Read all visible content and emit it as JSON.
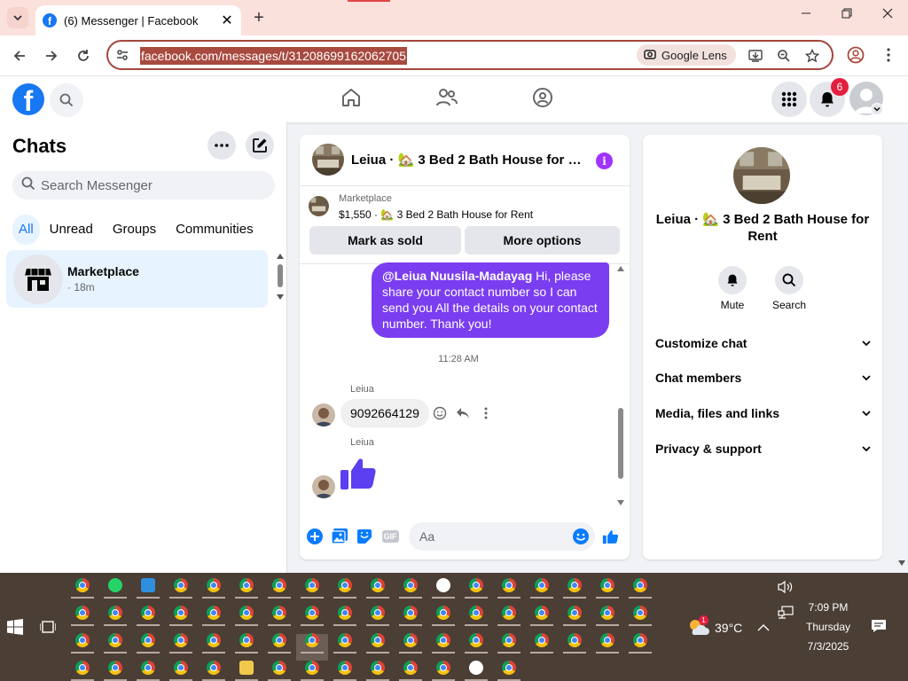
{
  "browser": {
    "tab_title": "(6) Messenger | Facebook",
    "tab_close": "✕",
    "new_tab": "+",
    "url": "facebook.com/messages/t/31208699162062705",
    "lens_label": "Google Lens",
    "accent_color": "#a84a3f"
  },
  "facebook": {
    "logo_letter": "f",
    "notification_count": "6",
    "brand_color": "#1877f2"
  },
  "chats": {
    "title": "Chats",
    "search_placeholder": "Search Messenger",
    "filters": [
      "All",
      "Unread",
      "Groups",
      "Communities"
    ],
    "active_filter": "All",
    "items": [
      {
        "name": "Marketplace",
        "meta": "· 18m"
      }
    ]
  },
  "conversation": {
    "title": "Leiua · 🏡 3 Bed 2 Bath House for R...",
    "marketplace_label": "Marketplace",
    "listing": "$1,550 · 🏡 3 Bed 2 Bath House for Rent",
    "mark_sold": "Mark as sold",
    "more_options": "More options",
    "outgoing": {
      "mention": "@Leiua Nuusila-Madayag",
      "text": " Hi, please share your contact number so I can send you All the details on your contact number. Thank you!"
    },
    "timestamp": "11:28 AM",
    "sender_name": "Leiua",
    "phone_message": "9092664129",
    "composer_placeholder": "Aa",
    "gif_label": "GIF",
    "accent_color": "#7b3df0"
  },
  "info_panel": {
    "name": "Leiua · 🏡 3 Bed 2 Bath House for Rent",
    "mute": "Mute",
    "search": "Search",
    "sections": [
      "Customize chat",
      "Chat members",
      "Media, files and links",
      "Privacy & support"
    ]
  },
  "taskbar": {
    "weather_temp": "39°C",
    "weather_badge": "1",
    "time": "7:09 PM",
    "day": "Thursday",
    "date": "7/3/2025"
  }
}
